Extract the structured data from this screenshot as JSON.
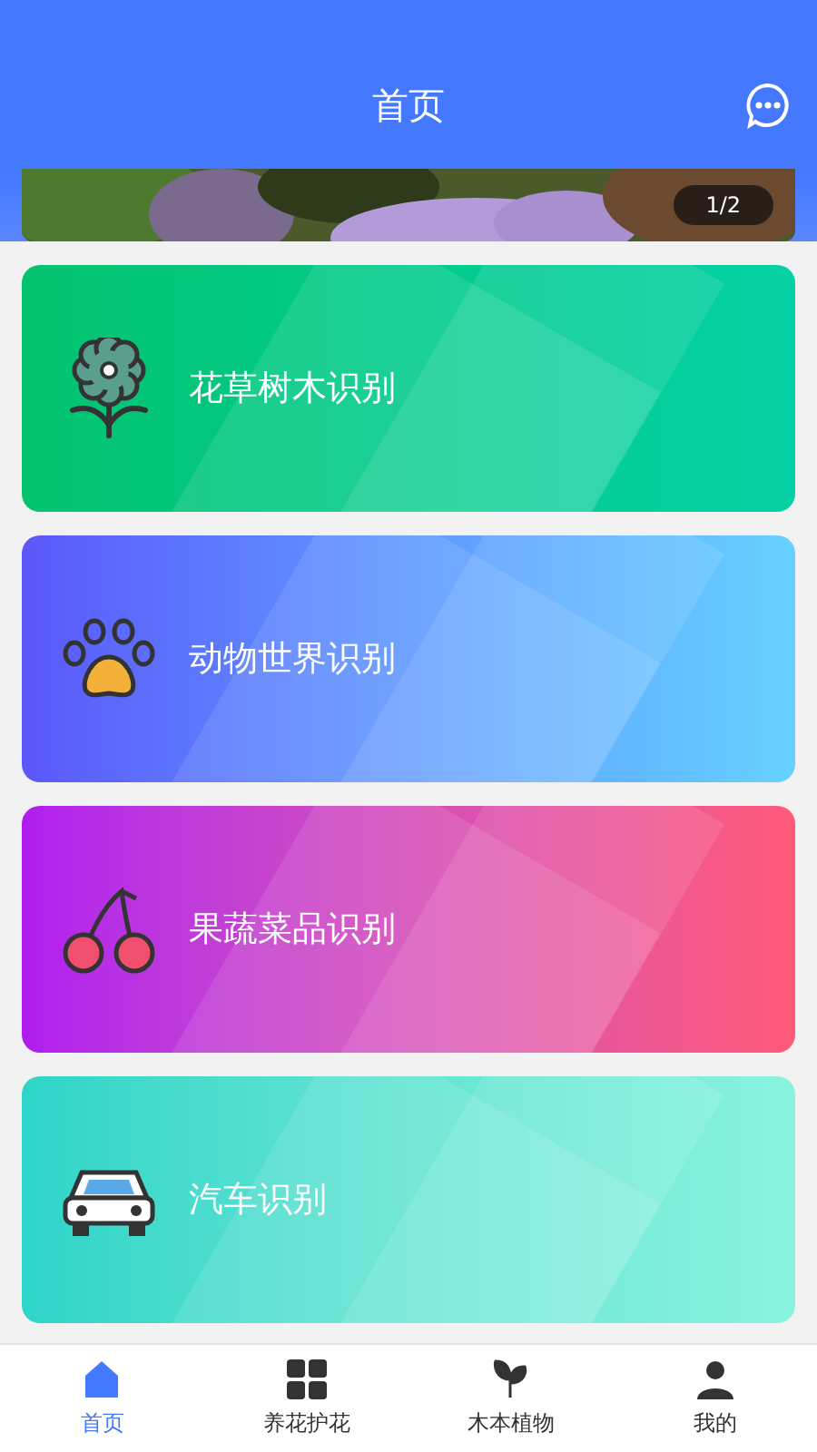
{
  "header": {
    "title": "首页"
  },
  "banner": {
    "kind": "picture",
    "counter": "1/2"
  },
  "cards": [
    {
      "kind": "flower",
      "label": "花草树木识别"
    },
    {
      "kind": "paw",
      "label": "动物世界识别"
    },
    {
      "kind": "cherry",
      "label": "果蔬菜品识别"
    },
    {
      "kind": "car",
      "label": "汽车识别"
    }
  ],
  "tabs": [
    {
      "kind": "home",
      "label": "首页",
      "selected": true
    },
    {
      "kind": "grid",
      "label": "养花护花",
      "selected": false
    },
    {
      "kind": "plant",
      "label": "木本植物",
      "selected": false
    },
    {
      "kind": "user",
      "label": "我的",
      "selected": false
    }
  ]
}
